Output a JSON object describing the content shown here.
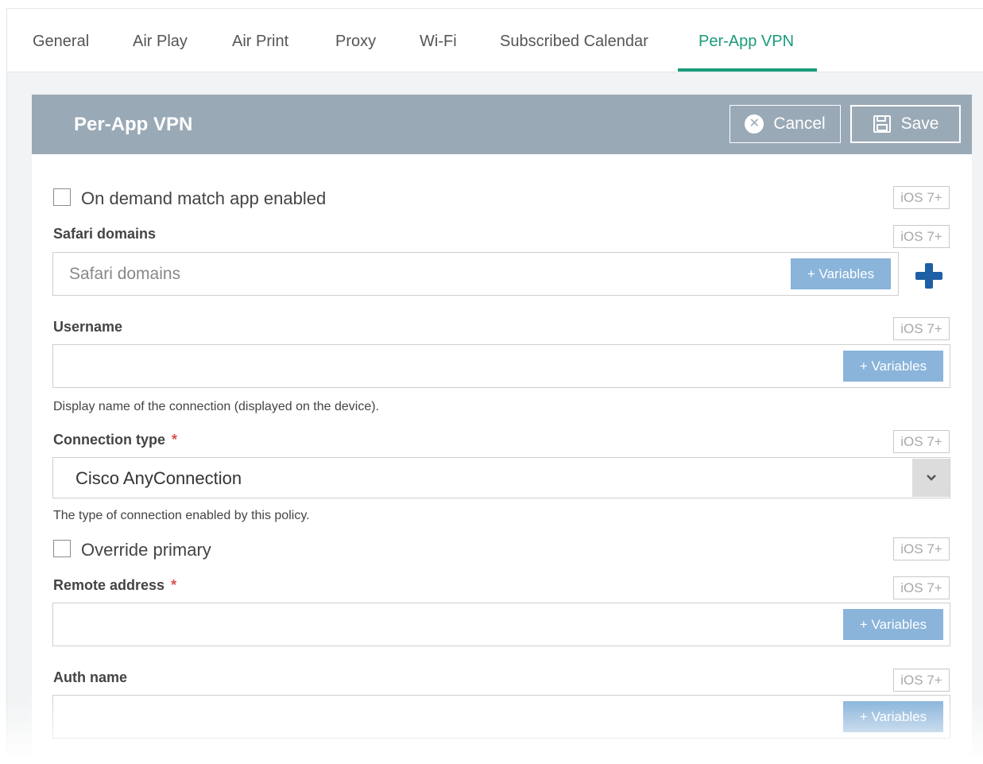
{
  "tabs": [
    {
      "label": "General"
    },
    {
      "label": "Air Play"
    },
    {
      "label": "Air Print"
    },
    {
      "label": "Proxy"
    },
    {
      "label": "Wi-Fi"
    },
    {
      "label": "Subscribed Calendar"
    },
    {
      "label": "Per-App VPN",
      "active": true
    }
  ],
  "panel": {
    "title": "Per-App VPN",
    "cancel_label": "Cancel",
    "save_label": "Save"
  },
  "form": {
    "ios_badge": "iOS 7+",
    "variables_label": "+ Variables",
    "required_mark": "*",
    "on_demand": {
      "label": "On demand match app enabled",
      "checked": false
    },
    "safari_domains": {
      "label": "Safari domains",
      "placeholder": "Safari domains",
      "value": ""
    },
    "username": {
      "label": "Username",
      "value": "",
      "helper": "Display name of the connection (displayed on the device)."
    },
    "connection_type": {
      "label": "Connection type",
      "value": "Cisco AnyConnection",
      "helper": "The type of connection enabled by this policy."
    },
    "override_primary": {
      "label": "Override primary",
      "checked": false
    },
    "remote_address": {
      "label": "Remote address",
      "value": ""
    },
    "auth_name": {
      "label": "Auth name",
      "value": ""
    }
  },
  "colors": {
    "accent": "#1a9b7a",
    "header_bg": "#9aa9b6",
    "variables_bg": "#8ab4da",
    "plus_icon": "#1e5fa5",
    "required": "#d9534f"
  }
}
